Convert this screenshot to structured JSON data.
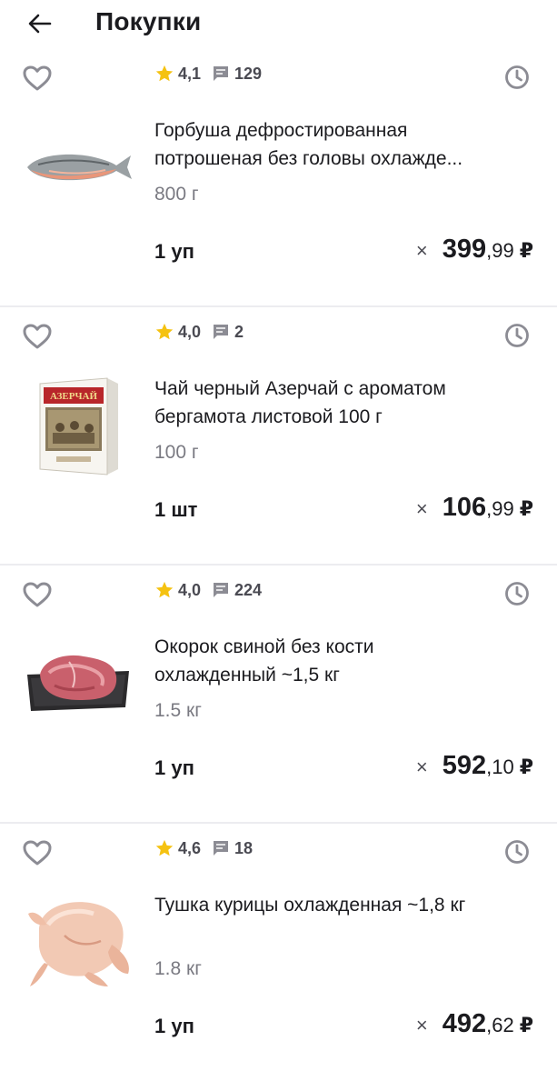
{
  "header": {
    "title": "Покупки",
    "back_icon": "arrow-left-icon"
  },
  "colors": {
    "star": "#f5c211",
    "icon_gray": "#8c8c94",
    "divider": "#ececf0"
  },
  "items": [
    {
      "rating": "4,1",
      "reviews": "129",
      "name": "Горбуша дефростированная потрошеная без головы охлажде...",
      "weight": "800 г",
      "qty": "1 уп",
      "times": "×",
      "price_main": "399",
      "price_dec": ",99",
      "currency": "₽",
      "image": "fish"
    },
    {
      "rating": "4,0",
      "reviews": "2",
      "name": "Чай черный Азерчай с ароматом бергамота листовой 100 г",
      "weight": "100 г",
      "qty": "1 шт",
      "times": "×",
      "price_main": "106",
      "price_dec": ",99",
      "currency": "₽",
      "image": "tea-box",
      "brand_text": "АЗЕРЧАЙ"
    },
    {
      "rating": "4,0",
      "reviews": "224",
      "name": "Окорок свиной без кости охлажденный ~1,5 кг",
      "weight": "1.5 кг",
      "qty": "1 уп",
      "times": "×",
      "price_main": "592",
      "price_dec": ",10",
      "currency": "₽",
      "image": "pork"
    },
    {
      "rating": "4,6",
      "reviews": "18",
      "name": "Тушка курицы охлажденная ~1,8 кг",
      "weight": "1.8 кг",
      "qty": "1 уп",
      "times": "×",
      "price_main": "492",
      "price_dec": ",62",
      "currency": "₽",
      "image": "chicken"
    }
  ]
}
